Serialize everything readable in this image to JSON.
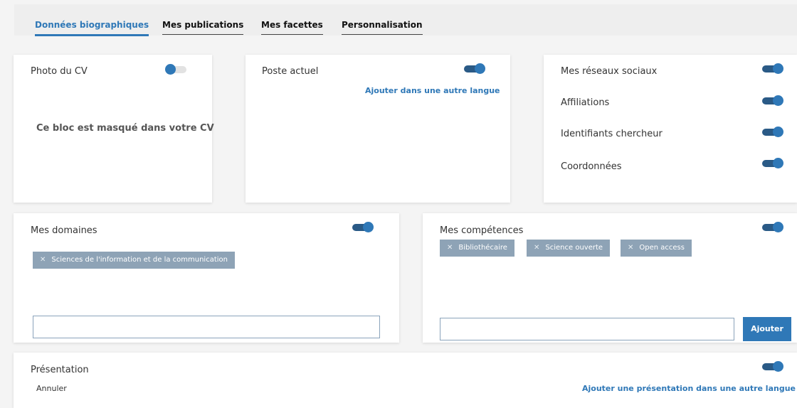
{
  "tabs": [
    {
      "label": "Données biographiques",
      "active": true
    },
    {
      "label": "Mes publications",
      "active": false
    },
    {
      "label": "Mes facettes",
      "active": false
    },
    {
      "label": "Personnalisation",
      "active": false
    }
  ],
  "photo": {
    "title": "Photo du CV",
    "toggle_on": false,
    "masked_text": "Ce bloc est masqué dans votre CV"
  },
  "poste": {
    "title": "Poste actuel",
    "toggle_on": true,
    "add_language_link": "Ajouter dans une autre langue"
  },
  "social": {
    "items": [
      {
        "label": "Mes réseaux sociaux",
        "toggle_on": true
      },
      {
        "label": "Affiliations",
        "toggle_on": true
      },
      {
        "label": "Identifiants chercheur",
        "toggle_on": true
      },
      {
        "label": "Coordonnées",
        "toggle_on": true
      }
    ]
  },
  "domaines": {
    "title": "Mes domaines",
    "toggle_on": true,
    "tags": [
      "Sciences de l'information et de la communication"
    ],
    "input_value": ""
  },
  "competences": {
    "title": "Mes compétences",
    "toggle_on": true,
    "tags": [
      "Bibliothécaire",
      "Science ouverte",
      "Open access"
    ],
    "input_value": "",
    "add_button": "Ajouter"
  },
  "presentation": {
    "title": "Présentation",
    "toggle_on": true,
    "cancel_label": "Annuler",
    "add_language_link": "Ajouter une présentation dans une autre langue"
  },
  "colors": {
    "accent": "#2f78b7",
    "toggle_track": "#2a5a86",
    "tag_bg": "#8ea3b6",
    "page_bg": "#f4f4f4"
  }
}
